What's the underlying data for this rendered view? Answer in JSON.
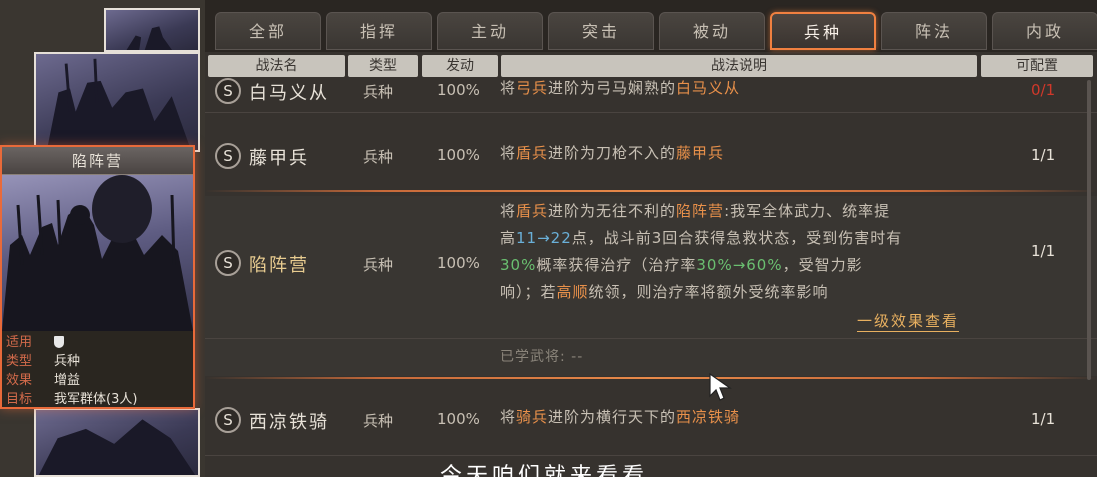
{
  "tabs": [
    {
      "label": "全部"
    },
    {
      "label": "指挥"
    },
    {
      "label": "主动"
    },
    {
      "label": "突击"
    },
    {
      "label": "被动"
    },
    {
      "label": "兵种"
    },
    {
      "label": "阵法"
    },
    {
      "label": "内政"
    }
  ],
  "active_tab": "兵种",
  "columns": {
    "name": "战法名",
    "type": "类型",
    "trigger": "发动",
    "desc": "战法说明",
    "config": "可配置"
  },
  "card": {
    "title": "陷阵营",
    "info": [
      {
        "key": "适用",
        "value": ""
      },
      {
        "key": "类型",
        "value": "兵种"
      },
      {
        "key": "效果",
        "value": "增益"
      },
      {
        "key": "目标",
        "value": "我军群体(3人)"
      }
    ]
  },
  "rows": [
    {
      "badge": "S",
      "name": "白马义从",
      "type": "兵种",
      "rate": "100%",
      "desc": {
        "p1": "将",
        "h1": "弓兵",
        "p2": "进阶为弓马娴熟的",
        "h2": "白马义从"
      },
      "config": "0/1",
      "config_color": "#d0382a"
    },
    {
      "badge": "S",
      "name": "藤甲兵",
      "type": "兵种",
      "rate": "100%",
      "desc": {
        "p1": "将",
        "h1": "盾兵",
        "p2": "进阶为刀枪不入的",
        "h2": "藤甲兵"
      },
      "config": "1/1",
      "config_color": "#e8e2d8"
    },
    {
      "badge": "S",
      "name": "陷阵营",
      "type": "兵种",
      "rate": "100%",
      "desc_lines": [
        {
          "a": "将",
          "b": "盾兵",
          "c": "进阶为无往不利的",
          "d": "陷阵营",
          "e": ":我军全体武力、统率提"
        },
        {
          "a": "高",
          "b": "11→22",
          "c": "点，战斗前3回合获得急救状态，受到伤害时有"
        },
        {
          "a": "30%",
          "b": "概率获得治疗（治疗率",
          "c": "30%→60%",
          "d": "，受智力影"
        },
        {
          "a": "响）；若",
          "b": "高顺",
          "c": "统领，则治疗率将额外受统率影响"
        }
      ],
      "detail_link": "一级效果查看",
      "learned": "已学武将:  --",
      "config": "1/1",
      "config_color": "#e8e2d8"
    },
    {
      "badge": "S",
      "name": "西凉铁骑",
      "type": "兵种",
      "rate": "100%",
      "desc": {
        "p1": "将",
        "h1": "骑兵",
        "p2": "进阶为横行天下的",
        "h2": "西凉铁骑"
      },
      "config": "1/1",
      "config_color": "#e8e2d8"
    }
  ],
  "subtitle": "今天咱们就来看看"
}
